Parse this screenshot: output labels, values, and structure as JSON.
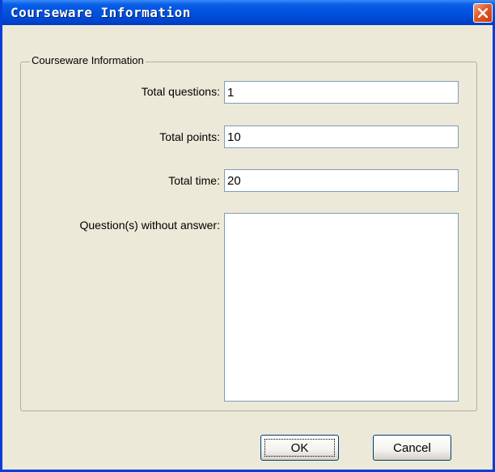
{
  "window": {
    "title": "Courseware Information",
    "close_icon": "close-icon"
  },
  "group": {
    "label": "Courseware Information"
  },
  "fields": {
    "total_questions": {
      "label": "Total questions:",
      "value": "1"
    },
    "total_points": {
      "label": "Total points:",
      "value": "10"
    },
    "total_time": {
      "label": "Total time:",
      "value": "20"
    },
    "unanswered": {
      "label": "Question(s) without answer:",
      "value": ""
    }
  },
  "buttons": {
    "ok": "OK",
    "cancel": "Cancel"
  },
  "colors": {
    "titlebar": "#0052e0",
    "dialog_bg": "#ece9d8",
    "close_button": "#e05a2a"
  }
}
